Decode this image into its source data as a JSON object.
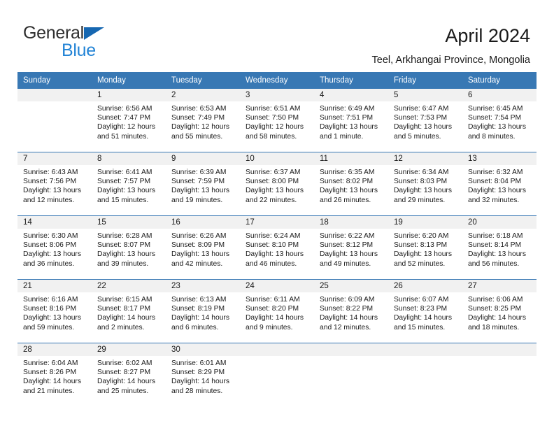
{
  "brand": {
    "name_top": "General",
    "name_bottom": "Blue",
    "triangle_color": "#1667b1",
    "blue_color": "#2384d6"
  },
  "header": {
    "title": "April 2024",
    "subtitle": "Teel, Arkhangai Province, Mongolia"
  },
  "colors": {
    "header_blue": "#3878b4",
    "daynum_band": "#f1f1f1",
    "text": "#1a1a1a"
  },
  "calendar": {
    "weekday_headers": [
      "Sunday",
      "Monday",
      "Tuesday",
      "Wednesday",
      "Thursday",
      "Friday",
      "Saturday"
    ],
    "weeks": [
      [
        {
          "day": "",
          "lines": []
        },
        {
          "day": "1",
          "lines": [
            "Sunrise: 6:56 AM",
            "Sunset: 7:47 PM",
            "Daylight: 12 hours",
            "and 51 minutes."
          ]
        },
        {
          "day": "2",
          "lines": [
            "Sunrise: 6:53 AM",
            "Sunset: 7:49 PM",
            "Daylight: 12 hours",
            "and 55 minutes."
          ]
        },
        {
          "day": "3",
          "lines": [
            "Sunrise: 6:51 AM",
            "Sunset: 7:50 PM",
            "Daylight: 12 hours",
            "and 58 minutes."
          ]
        },
        {
          "day": "4",
          "lines": [
            "Sunrise: 6:49 AM",
            "Sunset: 7:51 PM",
            "Daylight: 13 hours",
            "and 1 minute."
          ]
        },
        {
          "day": "5",
          "lines": [
            "Sunrise: 6:47 AM",
            "Sunset: 7:53 PM",
            "Daylight: 13 hours",
            "and 5 minutes."
          ]
        },
        {
          "day": "6",
          "lines": [
            "Sunrise: 6:45 AM",
            "Sunset: 7:54 PM",
            "Daylight: 13 hours",
            "and 8 minutes."
          ]
        }
      ],
      [
        {
          "day": "7",
          "lines": [
            "Sunrise: 6:43 AM",
            "Sunset: 7:56 PM",
            "Daylight: 13 hours",
            "and 12 minutes."
          ]
        },
        {
          "day": "8",
          "lines": [
            "Sunrise: 6:41 AM",
            "Sunset: 7:57 PM",
            "Daylight: 13 hours",
            "and 15 minutes."
          ]
        },
        {
          "day": "9",
          "lines": [
            "Sunrise: 6:39 AM",
            "Sunset: 7:59 PM",
            "Daylight: 13 hours",
            "and 19 minutes."
          ]
        },
        {
          "day": "10",
          "lines": [
            "Sunrise: 6:37 AM",
            "Sunset: 8:00 PM",
            "Daylight: 13 hours",
            "and 22 minutes."
          ]
        },
        {
          "day": "11",
          "lines": [
            "Sunrise: 6:35 AM",
            "Sunset: 8:02 PM",
            "Daylight: 13 hours",
            "and 26 minutes."
          ]
        },
        {
          "day": "12",
          "lines": [
            "Sunrise: 6:34 AM",
            "Sunset: 8:03 PM",
            "Daylight: 13 hours",
            "and 29 minutes."
          ]
        },
        {
          "day": "13",
          "lines": [
            "Sunrise: 6:32 AM",
            "Sunset: 8:04 PM",
            "Daylight: 13 hours",
            "and 32 minutes."
          ]
        }
      ],
      [
        {
          "day": "14",
          "lines": [
            "Sunrise: 6:30 AM",
            "Sunset: 8:06 PM",
            "Daylight: 13 hours",
            "and 36 minutes."
          ]
        },
        {
          "day": "15",
          "lines": [
            "Sunrise: 6:28 AM",
            "Sunset: 8:07 PM",
            "Daylight: 13 hours",
            "and 39 minutes."
          ]
        },
        {
          "day": "16",
          "lines": [
            "Sunrise: 6:26 AM",
            "Sunset: 8:09 PM",
            "Daylight: 13 hours",
            "and 42 minutes."
          ]
        },
        {
          "day": "17",
          "lines": [
            "Sunrise: 6:24 AM",
            "Sunset: 8:10 PM",
            "Daylight: 13 hours",
            "and 46 minutes."
          ]
        },
        {
          "day": "18",
          "lines": [
            "Sunrise: 6:22 AM",
            "Sunset: 8:12 PM",
            "Daylight: 13 hours",
            "and 49 minutes."
          ]
        },
        {
          "day": "19",
          "lines": [
            "Sunrise: 6:20 AM",
            "Sunset: 8:13 PM",
            "Daylight: 13 hours",
            "and 52 minutes."
          ]
        },
        {
          "day": "20",
          "lines": [
            "Sunrise: 6:18 AM",
            "Sunset: 8:14 PM",
            "Daylight: 13 hours",
            "and 56 minutes."
          ]
        }
      ],
      [
        {
          "day": "21",
          "lines": [
            "Sunrise: 6:16 AM",
            "Sunset: 8:16 PM",
            "Daylight: 13 hours",
            "and 59 minutes."
          ]
        },
        {
          "day": "22",
          "lines": [
            "Sunrise: 6:15 AM",
            "Sunset: 8:17 PM",
            "Daylight: 14 hours",
            "and 2 minutes."
          ]
        },
        {
          "day": "23",
          "lines": [
            "Sunrise: 6:13 AM",
            "Sunset: 8:19 PM",
            "Daylight: 14 hours",
            "and 6 minutes."
          ]
        },
        {
          "day": "24",
          "lines": [
            "Sunrise: 6:11 AM",
            "Sunset: 8:20 PM",
            "Daylight: 14 hours",
            "and 9 minutes."
          ]
        },
        {
          "day": "25",
          "lines": [
            "Sunrise: 6:09 AM",
            "Sunset: 8:22 PM",
            "Daylight: 14 hours",
            "and 12 minutes."
          ]
        },
        {
          "day": "26",
          "lines": [
            "Sunrise: 6:07 AM",
            "Sunset: 8:23 PM",
            "Daylight: 14 hours",
            "and 15 minutes."
          ]
        },
        {
          "day": "27",
          "lines": [
            "Sunrise: 6:06 AM",
            "Sunset: 8:25 PM",
            "Daylight: 14 hours",
            "and 18 minutes."
          ]
        }
      ],
      [
        {
          "day": "28",
          "lines": [
            "Sunrise: 6:04 AM",
            "Sunset: 8:26 PM",
            "Daylight: 14 hours",
            "and 21 minutes."
          ]
        },
        {
          "day": "29",
          "lines": [
            "Sunrise: 6:02 AM",
            "Sunset: 8:27 PM",
            "Daylight: 14 hours",
            "and 25 minutes."
          ]
        },
        {
          "day": "30",
          "lines": [
            "Sunrise: 6:01 AM",
            "Sunset: 8:29 PM",
            "Daylight: 14 hours",
            "and 28 minutes."
          ]
        },
        {
          "day": "",
          "lines": []
        },
        {
          "day": "",
          "lines": []
        },
        {
          "day": "",
          "lines": []
        },
        {
          "day": "",
          "lines": []
        }
      ]
    ]
  }
}
